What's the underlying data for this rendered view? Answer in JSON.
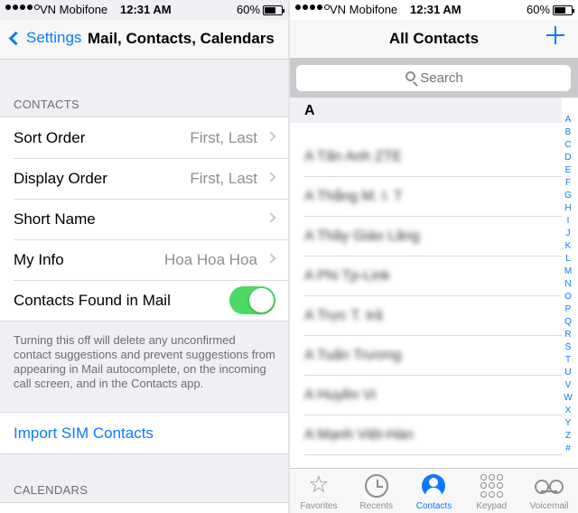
{
  "left": {
    "status": {
      "carrier": "VN Mobifone",
      "time": "12:31 AM",
      "battery": "60%"
    },
    "nav": {
      "back_label": "Settings",
      "title": "Mail, Contacts, Calendars"
    },
    "contacts_header": "CONTACTS",
    "rows": [
      {
        "label": "Sort Order",
        "value": "First, Last"
      },
      {
        "label": "Display Order",
        "value": "First, Last"
      },
      {
        "label": "Short Name",
        "value": ""
      },
      {
        "label": "My Info",
        "value": "Hoa Hoa Hoa"
      }
    ],
    "toggle_row": {
      "label": "Contacts Found in Mail",
      "on": true
    },
    "footer": "Turning this off will delete any unconfirmed contact suggestions and prevent suggestions from appearing in Mail autocomplete, on the incoming call screen, and in the Contacts app.",
    "import_label": "Import SIM Contacts",
    "calendars_header": "CALENDARS"
  },
  "right": {
    "status": {
      "carrier": "VN Mobifone",
      "time": "12:31 AM",
      "battery": "60%"
    },
    "nav": {
      "title": "All Contacts"
    },
    "search": {
      "placeholder": "Search"
    },
    "section_letter": "A",
    "contacts": [
      "A Tấn Anh ZTE",
      "A Thắng M. I. T",
      "A Thầy Giáo Lăng",
      "A Phi Tp-Link",
      "A Trực T. trả",
      "A Tuấn Trương",
      "A Huyền Vi",
      "A Mạnh Việt-Hàn"
    ],
    "index": [
      "A",
      "B",
      "C",
      "D",
      "E",
      "F",
      "G",
      "H",
      "I",
      "J",
      "K",
      "L",
      "M",
      "N",
      "O",
      "P",
      "Q",
      "R",
      "S",
      "T",
      "U",
      "V",
      "W",
      "X",
      "Y",
      "Z",
      "#"
    ],
    "tabs": [
      {
        "label": "Favorites",
        "icon": "star-icon"
      },
      {
        "label": "Recents",
        "icon": "clock-icon"
      },
      {
        "label": "Contacts",
        "icon": "person-circle-icon"
      },
      {
        "label": "Keypad",
        "icon": "keypad-icon"
      },
      {
        "label": "Voicemail",
        "icon": "voicemail-icon"
      }
    ]
  },
  "colors": {
    "accent": "#0a7aff",
    "toggle_on": "#4cd964",
    "background": "#efeff4"
  },
  "battery_level": 0.6
}
